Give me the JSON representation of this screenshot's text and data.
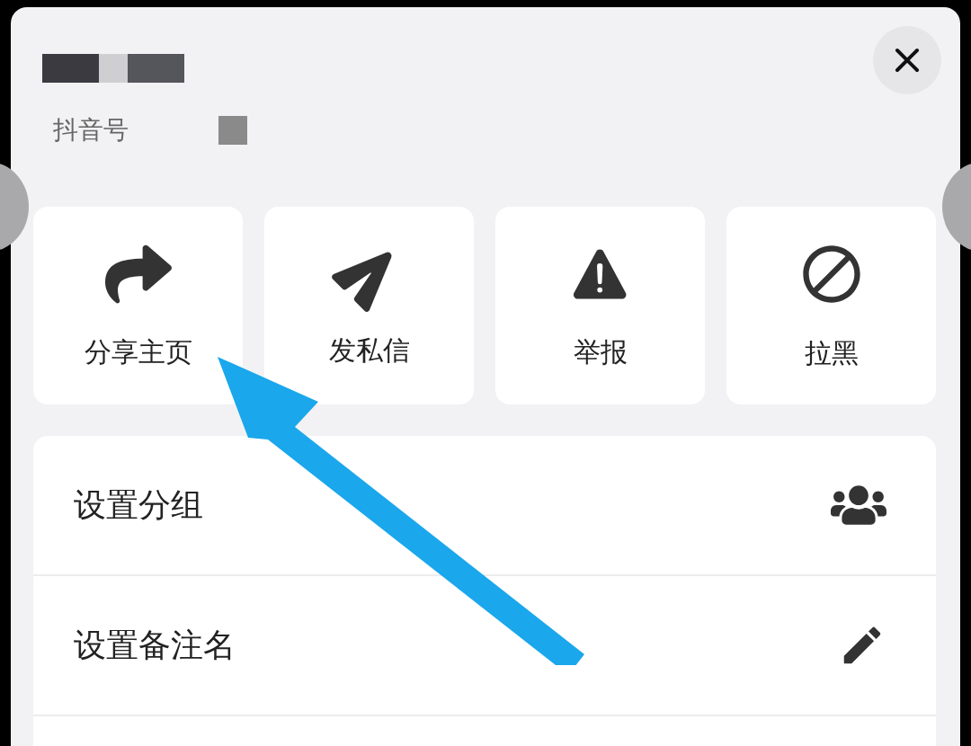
{
  "profile": {
    "id_label": "抖音号"
  },
  "actions": [
    {
      "kind": "share",
      "label": "分享主页"
    },
    {
      "kind": "message",
      "label": "发私信"
    },
    {
      "kind": "report",
      "label": "举报"
    },
    {
      "kind": "block",
      "label": "拉黑"
    }
  ],
  "menu": [
    {
      "kind": "group",
      "label": "设置分组"
    },
    {
      "kind": "remark",
      "label": "设置备注名"
    }
  ]
}
